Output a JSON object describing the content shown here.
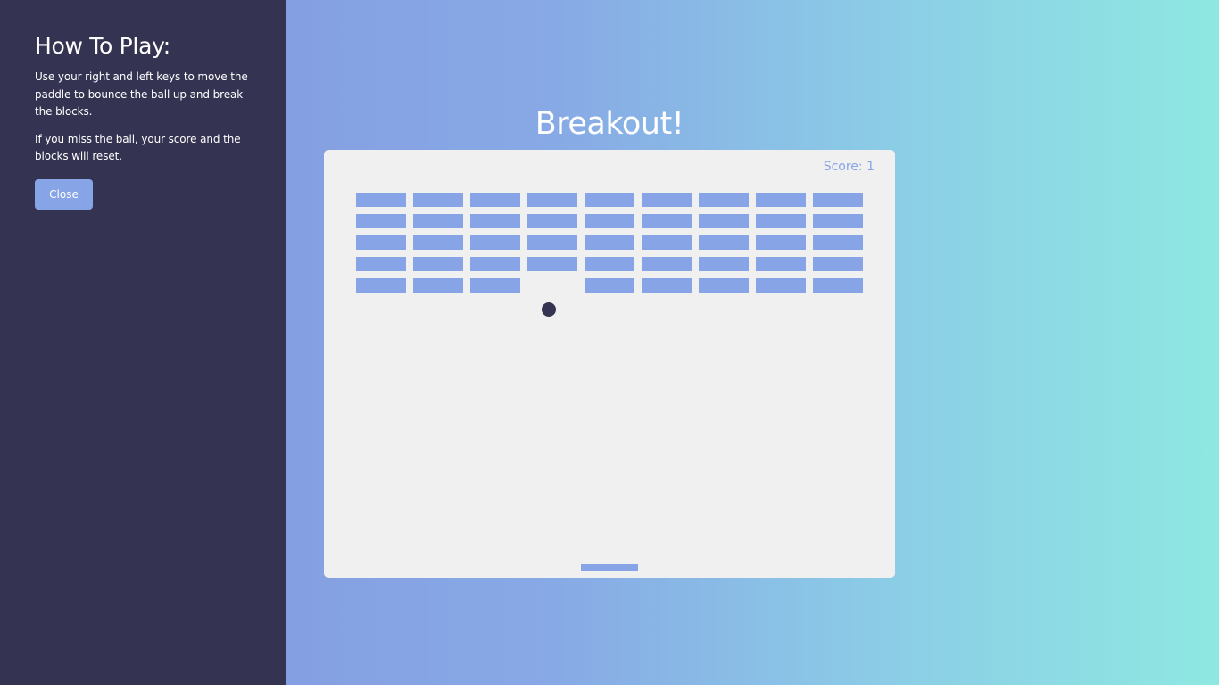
{
  "rules": {
    "title": "How To Play:",
    "paragraphs": [
      "Use your right and left keys to move the paddle to bounce the ball up and break the blocks.",
      "If you miss the ball, your score and the blocks will reset."
    ],
    "close_label": "Close"
  },
  "game": {
    "title": "Breakout!",
    "score_label": "Score: 1",
    "score": 1,
    "brick_rows": 5,
    "brick_columns": 9,
    "broken_bricks": [
      {
        "row": 5,
        "column": 4
      }
    ]
  },
  "colors": {
    "sidebar": "#343452",
    "accent": "#87a5e6",
    "board": "#f0f0f0",
    "ball": "#343452",
    "text": "#ffffff"
  }
}
